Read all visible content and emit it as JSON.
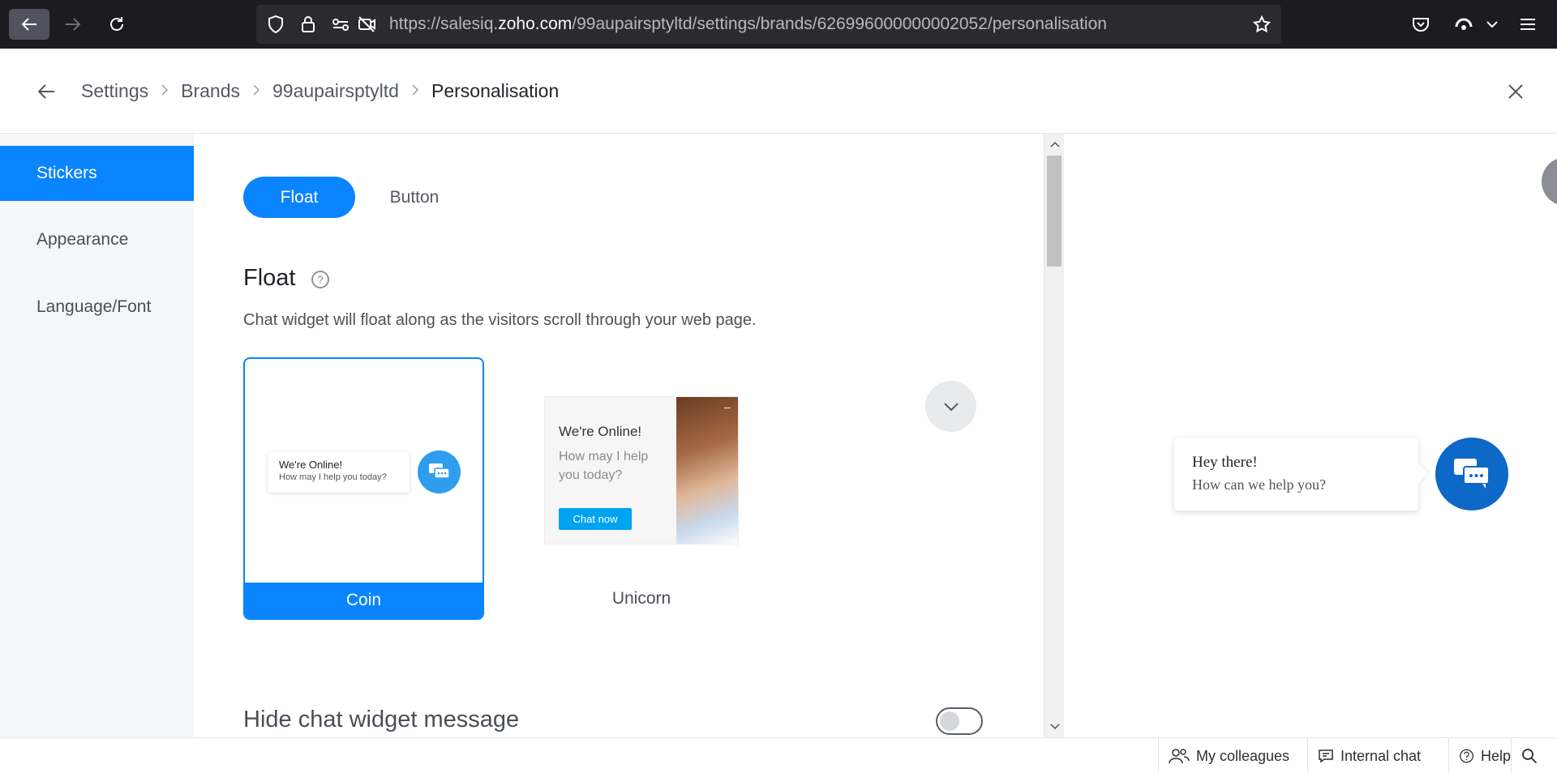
{
  "browser": {
    "url_prefix": "https://salesiq.",
    "url_domain": "zoho.com",
    "url_path": "/99aupairsptyltd/settings/brands/626996000000002052/personalisation"
  },
  "header": {
    "breadcrumb": [
      "Settings",
      "Brands",
      "99aupairsptyltd",
      "Personalisation"
    ]
  },
  "sidebar": {
    "items": [
      {
        "label": "Stickers"
      },
      {
        "label": "Appearance"
      },
      {
        "label": "Language/Font"
      }
    ]
  },
  "main": {
    "tabs": [
      {
        "label": "Float"
      },
      {
        "label": "Button"
      }
    ],
    "section_title": "Float",
    "section_desc": "Chat widget will float along as the visitors scroll through your web page.",
    "coin": {
      "label": "Coin",
      "preview_line1": "We're Online!",
      "preview_line2": "How may I help you today?"
    },
    "unicorn": {
      "label": "Unicorn",
      "preview_title": "We're Online!",
      "preview_sub": "How may I help you today?",
      "preview_button": "Chat now"
    },
    "hide_message_label": "Hide chat widget message"
  },
  "preview": {
    "line1": "Hey there!",
    "line2": "How can we help you?"
  },
  "footer": {
    "colleagues": "My colleagues",
    "internal_chat": "Internal chat",
    "help": "Help"
  },
  "colors": {
    "accent": "#0a84ff",
    "preview_button": "#0d68c7",
    "unicorn_button": "#00a3ef"
  },
  "icons": {
    "browser": [
      "back-arrow-icon",
      "forward-arrow-icon",
      "reload-icon",
      "shield-icon",
      "lock-icon",
      "permissions-icon",
      "camera-off-icon",
      "star-icon",
      "pocket-icon",
      "extension-icon",
      "chevron-down-icon",
      "menu-icon"
    ],
    "header": [
      "back-arrow-icon",
      "close-icon"
    ],
    "footer": [
      "colleagues-icon",
      "chat-icon",
      "help-icon",
      "search-icon"
    ]
  }
}
